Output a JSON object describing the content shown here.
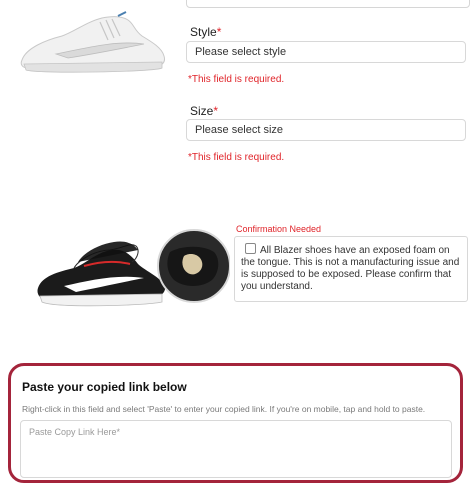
{
  "product": {
    "white_shoe_icon": "sneaker-white-icon",
    "black_shoe_icon": "sneaker-black-pair-icon"
  },
  "style": {
    "label": "Style",
    "required_mark": "*",
    "value": "Please select style",
    "error": "*This field is required."
  },
  "size": {
    "label": "Size",
    "required_mark": "*",
    "value": "Please select size",
    "error": "*This field is required."
  },
  "confirmation": {
    "heading": "Confirmation Needed",
    "checkbox_text": "All Blazer shoes have an exposed foam on the tongue. This is not a manufacturing issue and is supposed to be exposed. Please confirm that you understand."
  },
  "paste": {
    "title": "Paste your copied link below",
    "description": "Right-click in this field and select 'Paste' to enter your copied link. If you're on mobile, tap and hold to paste.",
    "placeholder": "Paste Copy Link Here*"
  },
  "colors": {
    "required_red": "#e0242a",
    "panel_border": "#a4243b"
  }
}
